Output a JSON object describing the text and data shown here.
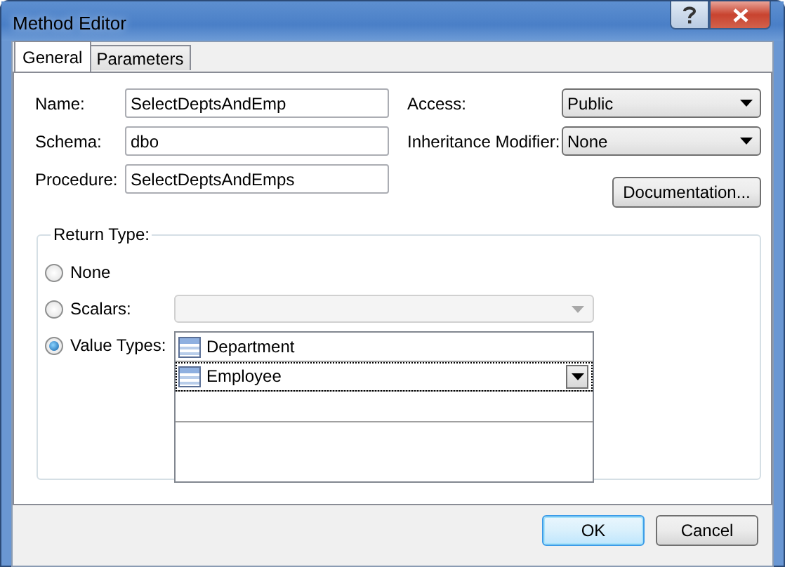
{
  "window": {
    "title": "Method Editor"
  },
  "tabs": [
    {
      "label": "General",
      "selected": true
    },
    {
      "label": "Parameters",
      "selected": false
    }
  ],
  "fields": [
    {
      "label": "Name:",
      "value": "SelectDeptsAndEmp"
    },
    {
      "label": "Schema:",
      "value": "dbo"
    },
    {
      "label": "Procedure:",
      "value": "SelectDeptsAndEmps"
    }
  ],
  "dropdowns": [
    {
      "label": "Access:",
      "value": "Public"
    },
    {
      "label": "Inheritance Modifier:",
      "value": "None"
    }
  ],
  "documentation_button": "Documentation...",
  "return_type": {
    "title": "Return Type:",
    "options": [
      {
        "label": "None",
        "selected": false,
        "kind": "plain"
      },
      {
        "label": "Scalars:",
        "selected": false,
        "kind": "combo",
        "disabled": true
      },
      {
        "label": "Value Types:",
        "selected": true,
        "kind": "list"
      }
    ],
    "value_types": [
      {
        "name": "Department",
        "selected": false
      },
      {
        "name": "Employee",
        "selected": true
      }
    ]
  },
  "buttons": [
    {
      "label": "OK",
      "default": true
    },
    {
      "label": "Cancel",
      "default": false
    }
  ]
}
